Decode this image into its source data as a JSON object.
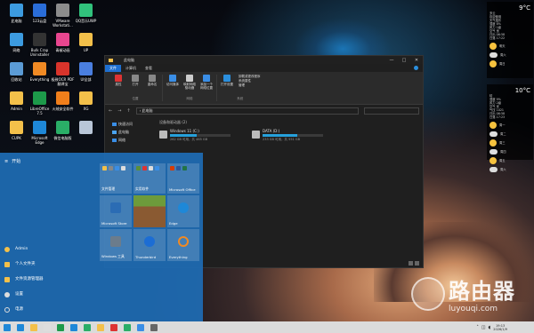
{
  "desktop": {
    "icons": [
      {
        "label": "此电脑",
        "color": "#3c9be0"
      },
      {
        "label": "123云盘",
        "color": "#2a6dd8"
      },
      {
        "label": "VMware Workstati...",
        "color": "#8c8c8c"
      },
      {
        "label": "QQ音乐UWP",
        "color": "#31c27c"
      },
      {
        "label": "网络",
        "color": "#3c9be0"
      },
      {
        "label": "Bulk Crap Uninstaller",
        "color": "#333333"
      },
      {
        "label": "青椒动画",
        "color": "#e8468f"
      },
      {
        "label": "UP",
        "color": "#f3c04a"
      },
      {
        "label": "回收站",
        "color": "#5b9bd5"
      },
      {
        "label": "Everything",
        "color": "#f08a24"
      },
      {
        "label": "极致OCR PDF翻译宝",
        "color": "#d9342b"
      },
      {
        "label": "UI全部",
        "color": "#4a7fe0"
      },
      {
        "label": "Admin",
        "color": "#f3c04a"
      },
      {
        "label": "LibreOffice 7.5",
        "color": "#1d9a4a"
      },
      {
        "label": "火绒安全软件",
        "color": "#f07e1b"
      },
      {
        "label": "XG",
        "color": "#f3c04a"
      },
      {
        "label": "CUPK",
        "color": "#f3c04a"
      },
      {
        "label": "Microsoft Edge",
        "color": "#1e88d8"
      },
      {
        "label": "微信电脑版",
        "color": "#2aae67"
      },
      {
        "label": "",
        "color": "#b9c6d8"
      }
    ]
  },
  "explorer": {
    "title": "此电脑",
    "tabs": [
      {
        "label": "文件",
        "active": true
      },
      {
        "label": "计算机",
        "active": false
      },
      {
        "label": "查看",
        "active": false
      }
    ],
    "ribbon_groups": [
      {
        "name": "位置",
        "items": [
          {
            "label": "属性",
            "color": "#d33"
          },
          {
            "label": "打开",
            "color": "#888"
          },
          {
            "label": "重命名",
            "color": "#888"
          }
        ]
      },
      {
        "name": "网络",
        "items": [
          {
            "label": "访问媒体",
            "color": "#3a8ee6"
          },
          {
            "label": "映射网络驱动器",
            "color": "#ccc"
          },
          {
            "label": "添加一个网络位置",
            "color": "#3a8ee6"
          }
        ]
      },
      {
        "name": "系统",
        "items": [
          {
            "label": "打开设置",
            "color": "#2b8fdd"
          }
        ]
      }
    ],
    "system_links": [
      "卸载或更改程序",
      "系统属性",
      "管理"
    ],
    "address": "此电脑",
    "nav_items": [
      {
        "label": "快速访问",
        "color": "#3a8ee6"
      },
      {
        "label": "此电脑",
        "color": "#4aa3ef"
      },
      {
        "label": "网络",
        "color": "#3a8ee6"
      }
    ],
    "section": "设备和驱动器 (2)",
    "drives": [
      {
        "name": "Windows 11 (C:)",
        "size": "262 GB 可用，共 465 GB",
        "used": 0.44
      },
      {
        "name": "DATA (D:)",
        "size": "233 GB 可用，共 551 GB",
        "used": 0.58
      }
    ]
  },
  "start_menu": {
    "header": "开始",
    "items": [
      {
        "label": "Admin",
        "color": "#f3c04a"
      },
      {
        "label": "个人文件夹",
        "color": "#f3c04a"
      },
      {
        "label": "文件资源管理器",
        "color": "#f3c04a"
      },
      {
        "label": "设置",
        "color": "#ddd"
      },
      {
        "label": "电源",
        "color": "#ddd"
      }
    ],
    "tiles": [
      {
        "label": "文件管理",
        "color": "#f3c04a"
      },
      {
        "label": "实用软件",
        "color": "#5a8f3a"
      },
      {
        "label": "Microsoft Office",
        "color": "#d73b02"
      },
      {
        "label": "Microsoft Store",
        "color": "#2b6cb4"
      },
      {
        "label": "",
        "color": "#6d9b3b"
      },
      {
        "label": "Edge",
        "color": "#1e88d8"
      },
      {
        "label": "Windows 工具",
        "color": "#6b7c8c"
      },
      {
        "label": "Thunderbird",
        "color": "#1c6dd4"
      },
      {
        "label": "Everything",
        "color": "#f08a24"
      }
    ]
  },
  "taskbar": {
    "icons": [
      "#1e88d8",
      "#f3c04a",
      "#ddd",
      "#1d9a4a",
      "#1e88d8",
      "#2aae67",
      "#f3c04a",
      "#d33",
      "#2aae67",
      "#3a8ee6",
      "#666666"
    ],
    "time": "19:13",
    "date": "2026/1/9"
  },
  "weather": [
    {
      "temp": "9°C",
      "lines": [
        "多云",
        "欢迎使用",
        "天气插件",
        "湿度 8%",
        "风力 1级",
        "空气 良",
        "日出 06:58",
        "日落 17:22"
      ],
      "forecast": [
        "明天",
        "周六",
        "周日"
      ]
    },
    {
      "temp": "10°C",
      "lines": [
        "晴",
        "湿度 9%",
        "风力 2级",
        "空气 优",
        "气压 1021",
        "日出 06:58",
        "日落 17:23"
      ],
      "forecast": [
        "周一",
        "周二",
        "周三",
        "周四",
        "周五",
        "周六"
      ]
    }
  ],
  "watermark": {
    "cn": "路由器",
    "en": "luyouqi.com"
  }
}
